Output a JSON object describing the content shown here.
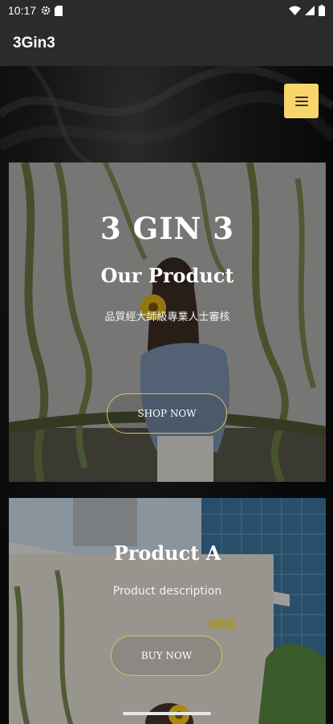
{
  "status_bar": {
    "time": "10:17"
  },
  "app_bar": {
    "title": "3Gin3"
  },
  "menu": {
    "icon": "hamburger-menu-icon"
  },
  "hero": {
    "brand": "3 GIN 3",
    "heading": "Our Product",
    "tagline": "品質經大師級專業人士審核",
    "button_label": "SHOP NOW"
  },
  "product": {
    "heading": "Product A",
    "description": "Product description",
    "button_label": "BUY NOW"
  },
  "colors": {
    "accent": "#f6d56b",
    "button_border": "#e2bd59",
    "app_bar": "#2b2b2b"
  }
}
